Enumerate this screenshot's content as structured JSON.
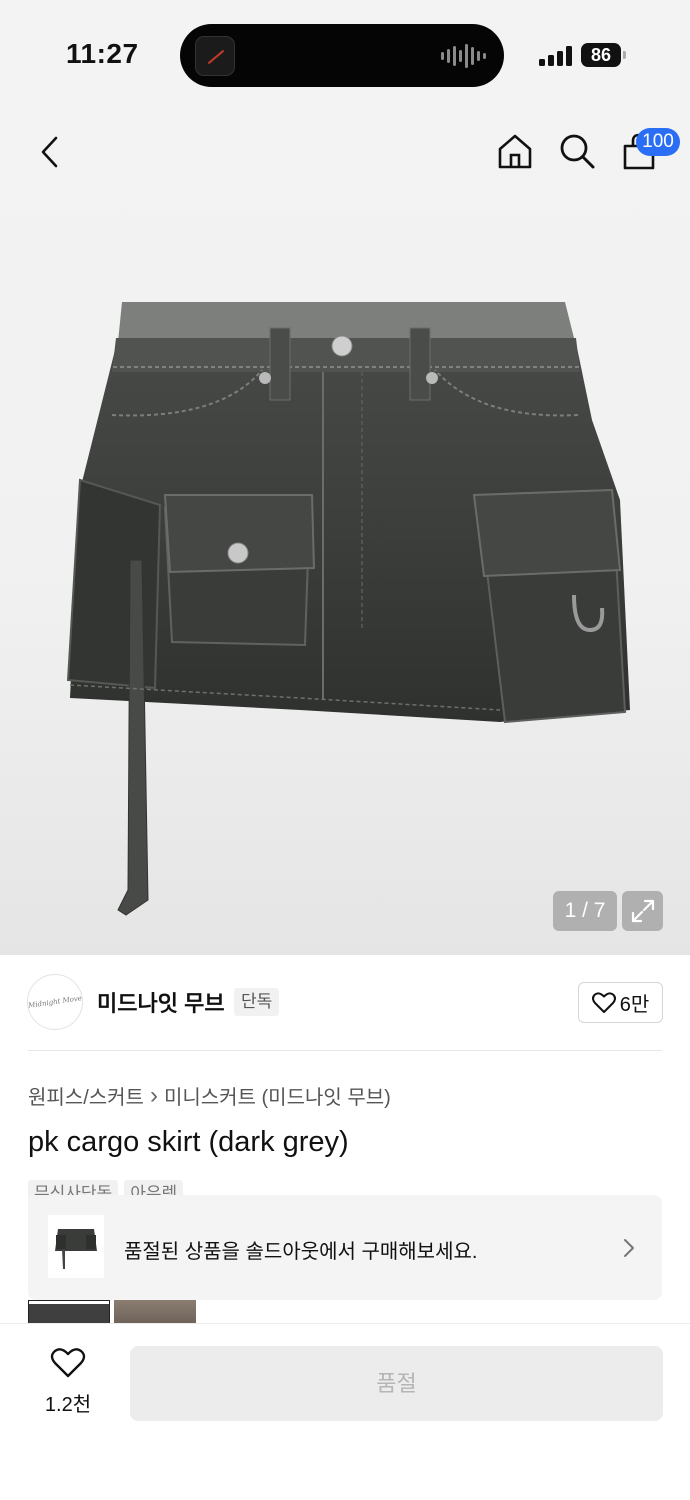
{
  "status_bar": {
    "time": "11:27",
    "battery": "86"
  },
  "header": {
    "cart_count": "100"
  },
  "gallery": {
    "counter": "1 / 7"
  },
  "brand": {
    "logo_text": "Midnight Move",
    "name": "미드나잇 무브",
    "tag": "단독",
    "likes": "6만"
  },
  "breadcrumb": {
    "category": "원피스/스커트",
    "separator": "›",
    "subcategory": "미니스커트 (미드나잇 무브)"
  },
  "product": {
    "title": "pk cargo skirt (dark grey)",
    "tags": [
      "무신사단독",
      "아우렛"
    ]
  },
  "soldout_banner": {
    "text": "품절된 상품을 솔드아웃에서 구매해보세요."
  },
  "bottom_bar": {
    "like_count": "1.2천",
    "buy_label": "품절"
  },
  "icons": [
    "back-icon",
    "home-icon",
    "search-icon",
    "cart-icon",
    "expand-icon",
    "heart-icon",
    "chevron-right-icon"
  ],
  "colors": {
    "badge": "#2b6ef6",
    "disabled_button": "#ececec"
  }
}
